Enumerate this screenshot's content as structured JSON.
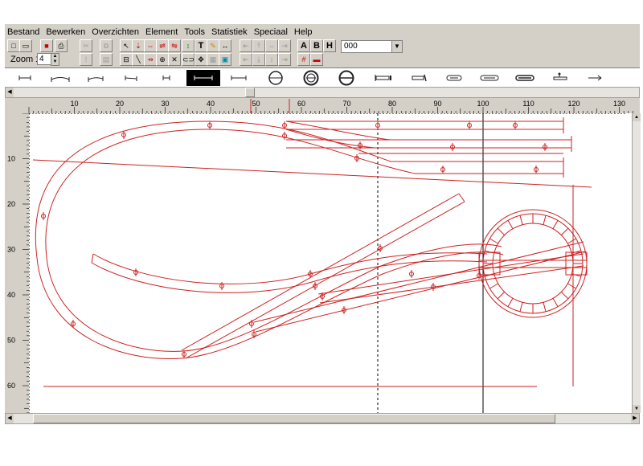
{
  "menu": [
    "Bestand",
    "Bewerken",
    "Overzichten",
    "Element",
    "Tools",
    "Statistiek",
    "Speciaal",
    "Help"
  ],
  "toolbar": {
    "zoom_label": "Zoom 1:",
    "zoom_value": "4",
    "text_tool": "T",
    "font_a": "A",
    "font_b": "B",
    "font_h": "H",
    "layer_value": "000"
  },
  "ruler": {
    "h_labels": [
      "10",
      "20",
      "30",
      "40",
      "50",
      "60",
      "70",
      "80",
      "90",
      "100",
      "110",
      "120",
      "130"
    ],
    "v_labels": [
      "10",
      "20",
      "30",
      "40",
      "50",
      "60"
    ]
  },
  "colors": {
    "track": "#cc2222",
    "ruler_mark": "#cc2222",
    "guide": "#000000",
    "selected_part_bg": "#000000"
  },
  "parts": [
    {
      "icon": "straight-track-icon"
    },
    {
      "icon": "curved-track-icon"
    },
    {
      "icon": "curved-track-icon"
    },
    {
      "icon": "straight-track-icon"
    },
    {
      "icon": "short-track-icon"
    },
    {
      "icon": "straight-track-selected-icon"
    },
    {
      "icon": "straight-track-icon"
    },
    {
      "icon": "turntable-icon"
    },
    {
      "icon": "turntable-icon"
    },
    {
      "icon": "turntable-icon"
    },
    {
      "icon": "buffer-track-icon"
    },
    {
      "icon": "buffer-track-icon"
    },
    {
      "icon": "rerailer-track-icon"
    },
    {
      "icon": "crossing-track-icon"
    },
    {
      "icon": "crossing-track-icon"
    },
    {
      "icon": "signal-track-icon"
    },
    {
      "icon": "signal-track-icon"
    }
  ]
}
